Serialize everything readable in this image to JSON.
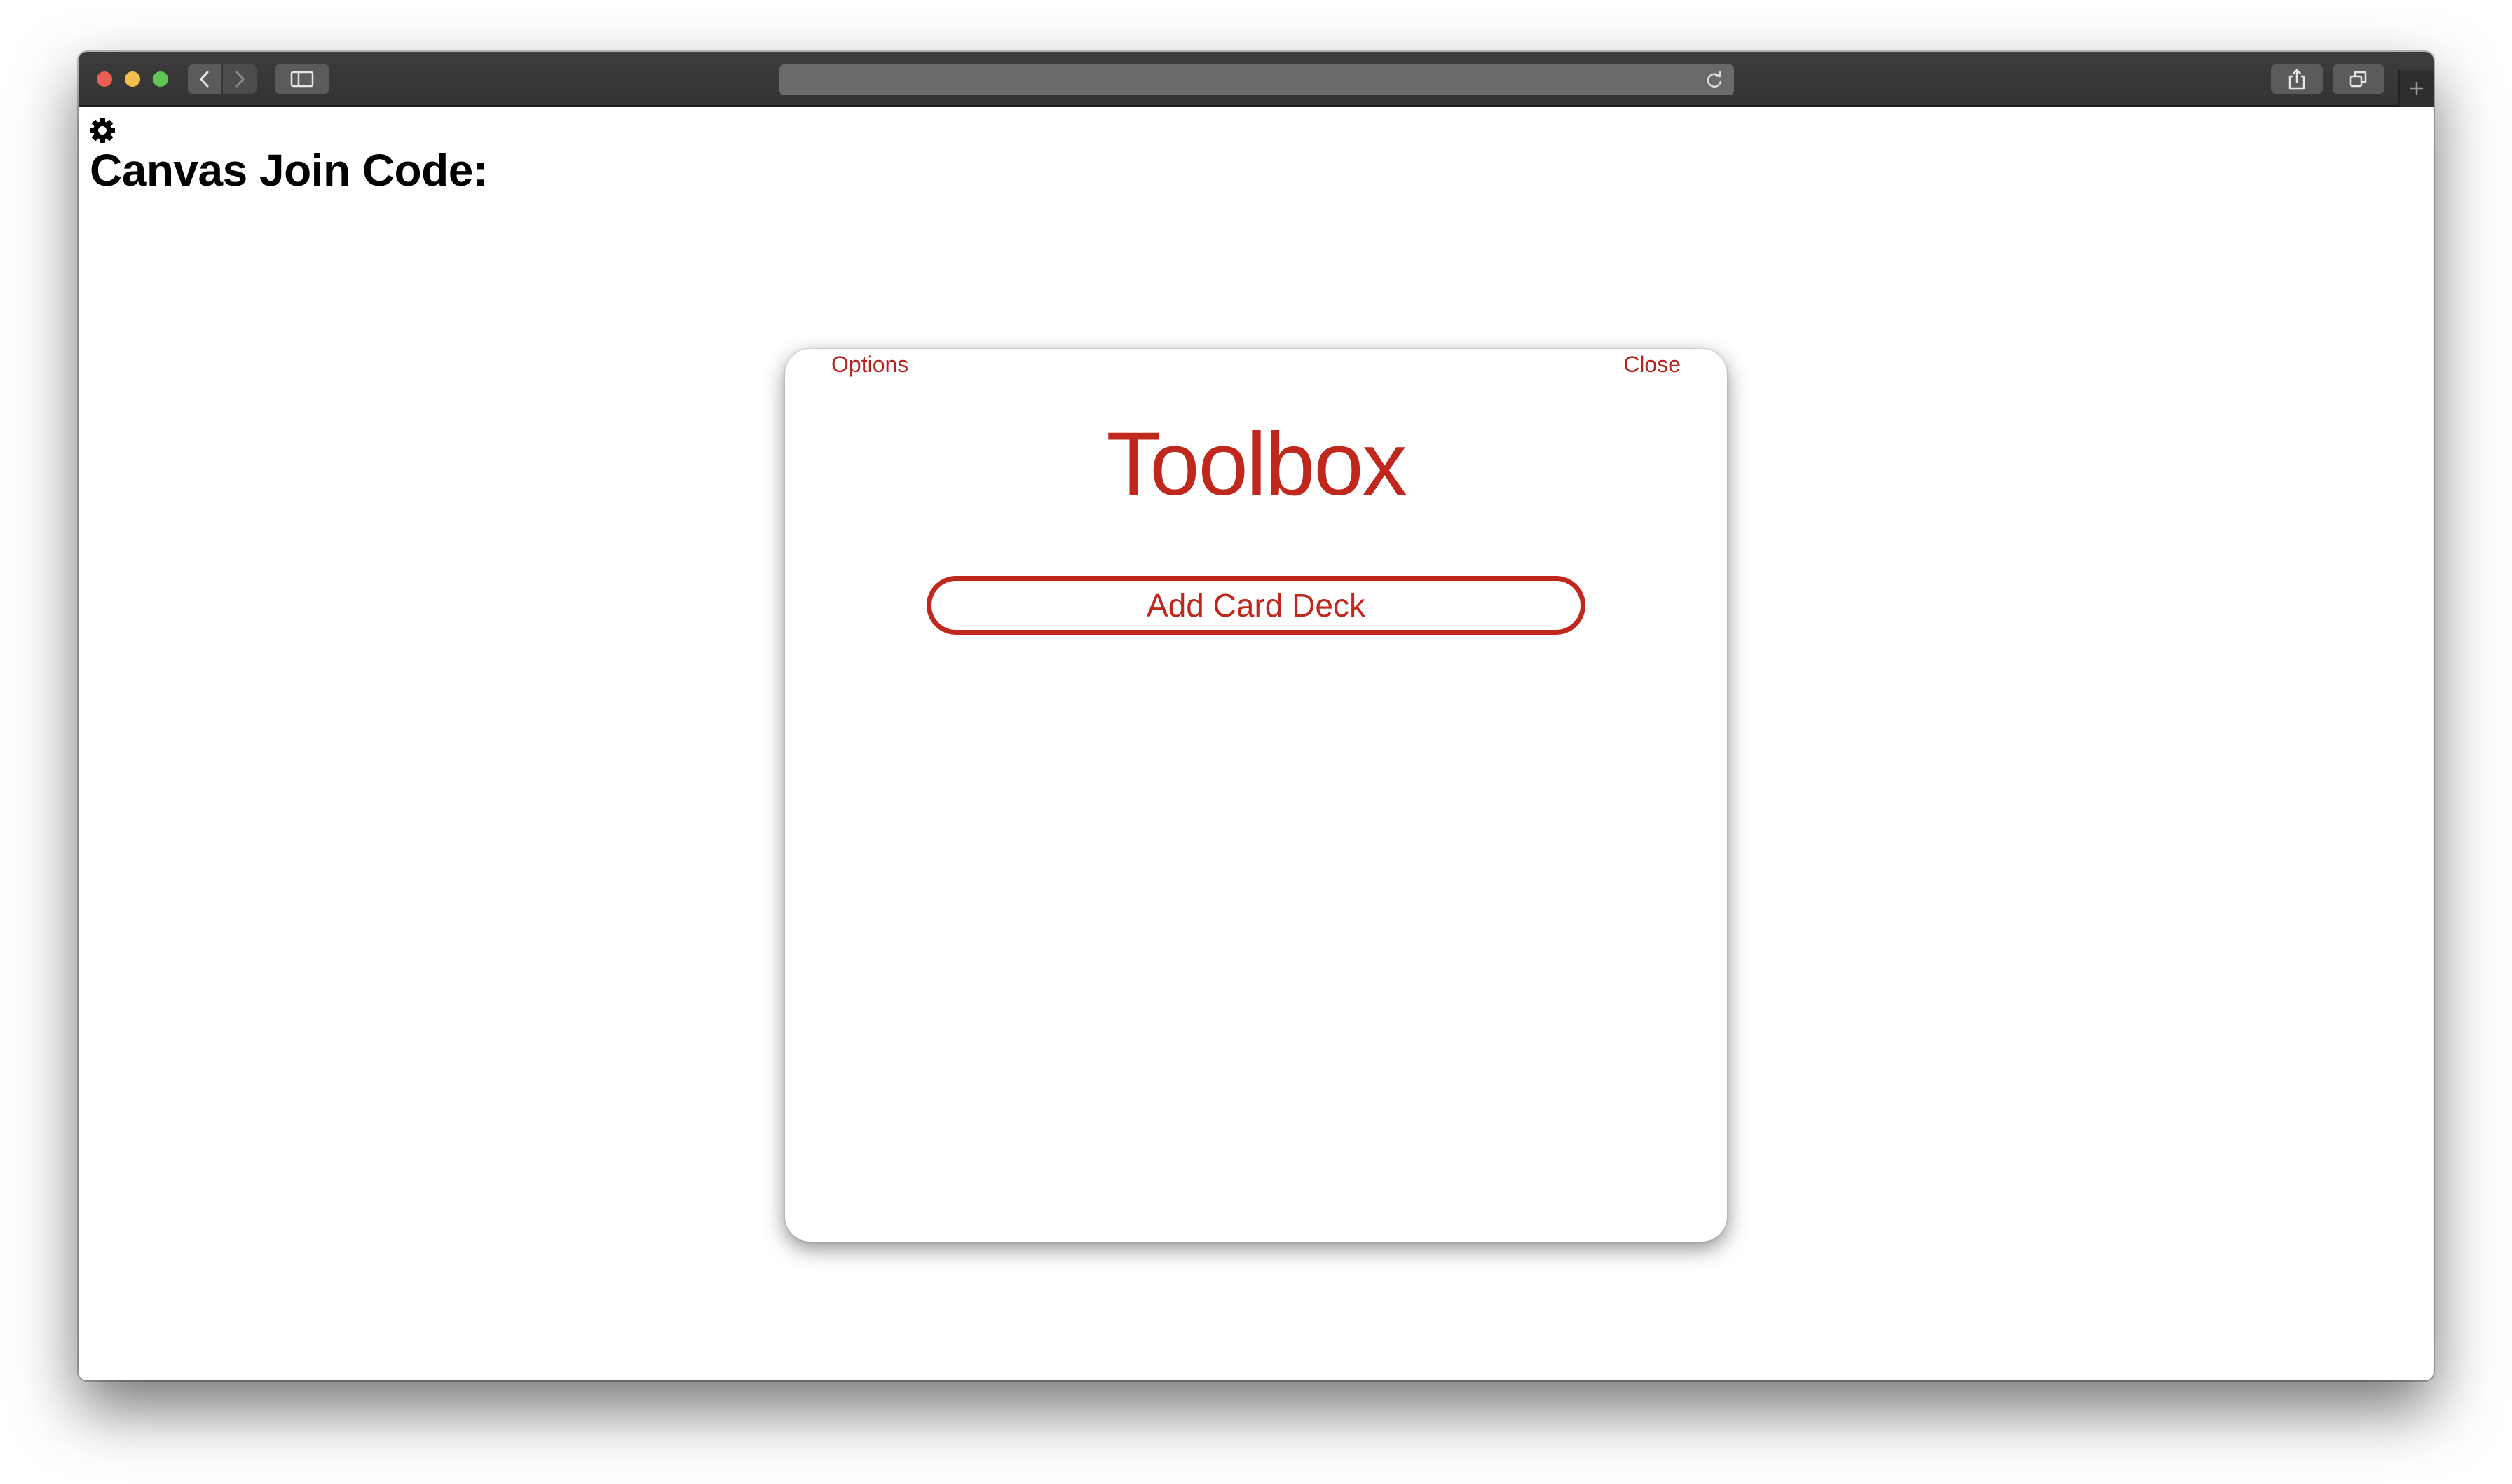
{
  "browser": {
    "address": "",
    "icons": {
      "back": "chevron-left-icon",
      "forward": "chevron-right-icon",
      "sidebar": "sidebar-icon",
      "reload": "reload-icon",
      "share": "share-icon",
      "tabs": "tabs-overview-icon",
      "new_tab": "plus-icon"
    },
    "traffic_colors": {
      "close": "#ed5e56",
      "minimize": "#f4bf4f",
      "zoom": "#61c554"
    }
  },
  "page": {
    "settings_icon": "gear-icon",
    "heading": "Canvas Join Code:"
  },
  "modal": {
    "options_label": "Options",
    "close_label": "Close",
    "title": "Toolbox",
    "add_button_label": "Add Card Deck",
    "accent_color": "#c0271d"
  }
}
